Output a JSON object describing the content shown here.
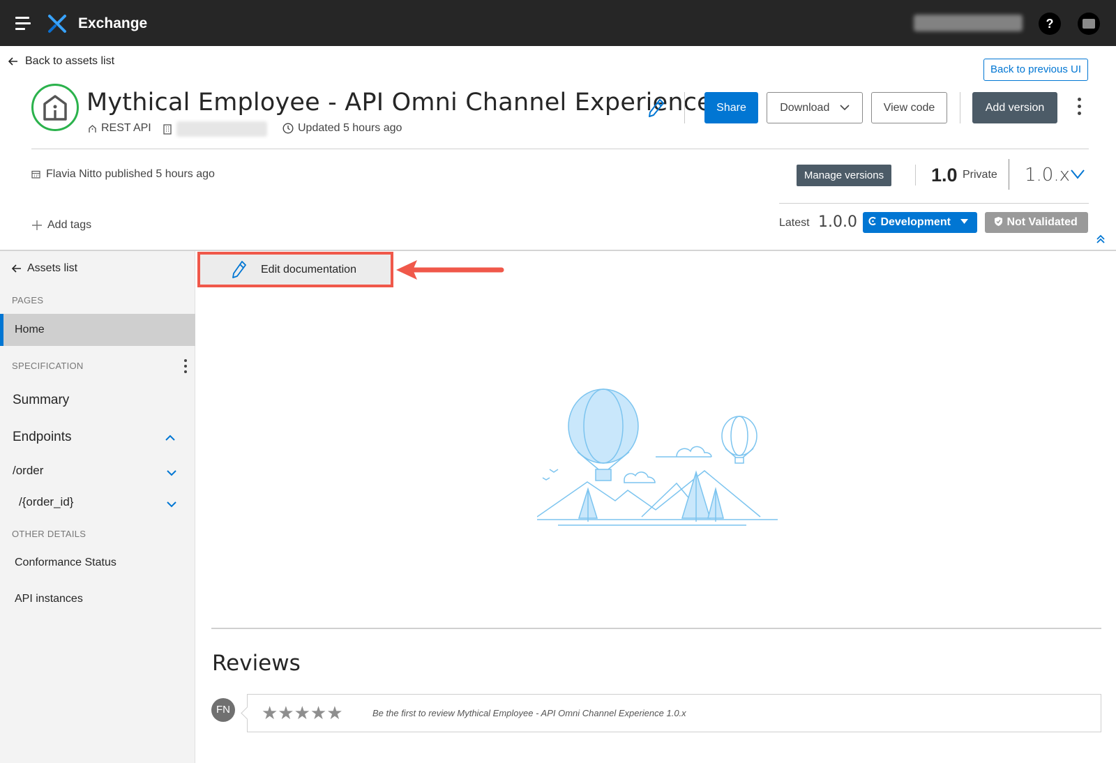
{
  "topbar": {
    "app_title": "Exchange",
    "help_label": "?"
  },
  "header": {
    "back_link": "Back to assets list",
    "back_previous": "Back to previous UI",
    "asset_title": "Mythical Employee - API Omni Channel Experience",
    "asset_type": "REST API",
    "updated": "Updated 5 hours ago",
    "buttons": {
      "share": "Share",
      "download": "Download",
      "view_code": "View code",
      "add_version": "Add version"
    },
    "published": "Flavia Nitto published 5 hours ago",
    "manage_versions": "Manage versions",
    "version": "1.0",
    "visibility": "Private",
    "version_range": "1.0.x",
    "add_tags": "Add tags",
    "latest_label": "Latest",
    "latest_value": "1.0.0",
    "lifecycle_state": "Development",
    "validation": "Not Validated"
  },
  "sidebar": {
    "assets_list": "Assets list",
    "pages_header": "PAGES",
    "home": "Home",
    "spec_header": "SPECIFICATION",
    "summary": "Summary",
    "endpoints": "Endpoints",
    "order": "/order",
    "order_id": "/{order_id}",
    "other_header": "OTHER DETAILS",
    "conformance": "Conformance Status",
    "api_instances": "API instances"
  },
  "content": {
    "edit_documentation": "Edit documentation",
    "reviews_title": "Reviews",
    "reviewer_initials": "FN",
    "stars": "★★★★★",
    "review_prompt": "Be the first to review Mythical Employee - API Omni Channel Experience 1.0.x"
  },
  "colors": {
    "accent": "#0176d3",
    "topbar": "#262626",
    "highlight": "#f0584a",
    "dark_button": "#4c5b67"
  }
}
